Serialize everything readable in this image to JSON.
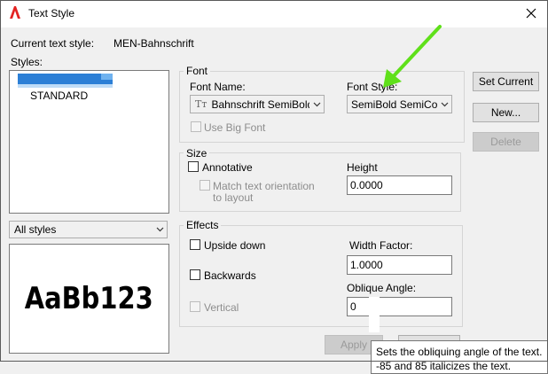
{
  "window": {
    "title": "Text Style",
    "close_icon": "close-icon",
    "app_icon": "autocad-icon",
    "accent": "#e32322"
  },
  "current_style": {
    "label": "Current text style:",
    "value": "MEN-Bahnschrift"
  },
  "styles": {
    "label": "Styles:",
    "items": [
      "STANDARD"
    ],
    "filter_value": "All styles"
  },
  "preview": {
    "sample_text": "AaBb123"
  },
  "font": {
    "group_label": "Font",
    "font_name_label": "Font Name:",
    "font_name_value": "Bahnschrift SemiBold Se",
    "font_style_label": "Font Style:",
    "font_style_value": "SemiBold SemiCond",
    "use_big_font_label": "Use Big Font"
  },
  "size": {
    "group_label": "Size",
    "annotative_label": "Annotative",
    "match_orientation_label_line1": "Match text orientation",
    "match_orientation_label_line2": "to layout",
    "height_label": "Height",
    "height_value": "0.0000"
  },
  "effects": {
    "group_label": "Effects",
    "upside_down_label": "Upside down",
    "backwards_label": "Backwards",
    "vertical_label": "Vertical",
    "width_factor_label": "Width Factor:",
    "width_factor_value": "1.0000",
    "oblique_angle_label": "Oblique Angle:",
    "oblique_angle_value": "0"
  },
  "buttons": {
    "set_current": "Set Current",
    "new": "New...",
    "delete": "Delete",
    "apply": "Apply"
  },
  "tooltip": {
    "line1": "Sets the obliquing angle of the text.",
    "line2": "-85 and 85 italicizes the text."
  },
  "annotation": {
    "arrow_color": "#5fe01a"
  }
}
